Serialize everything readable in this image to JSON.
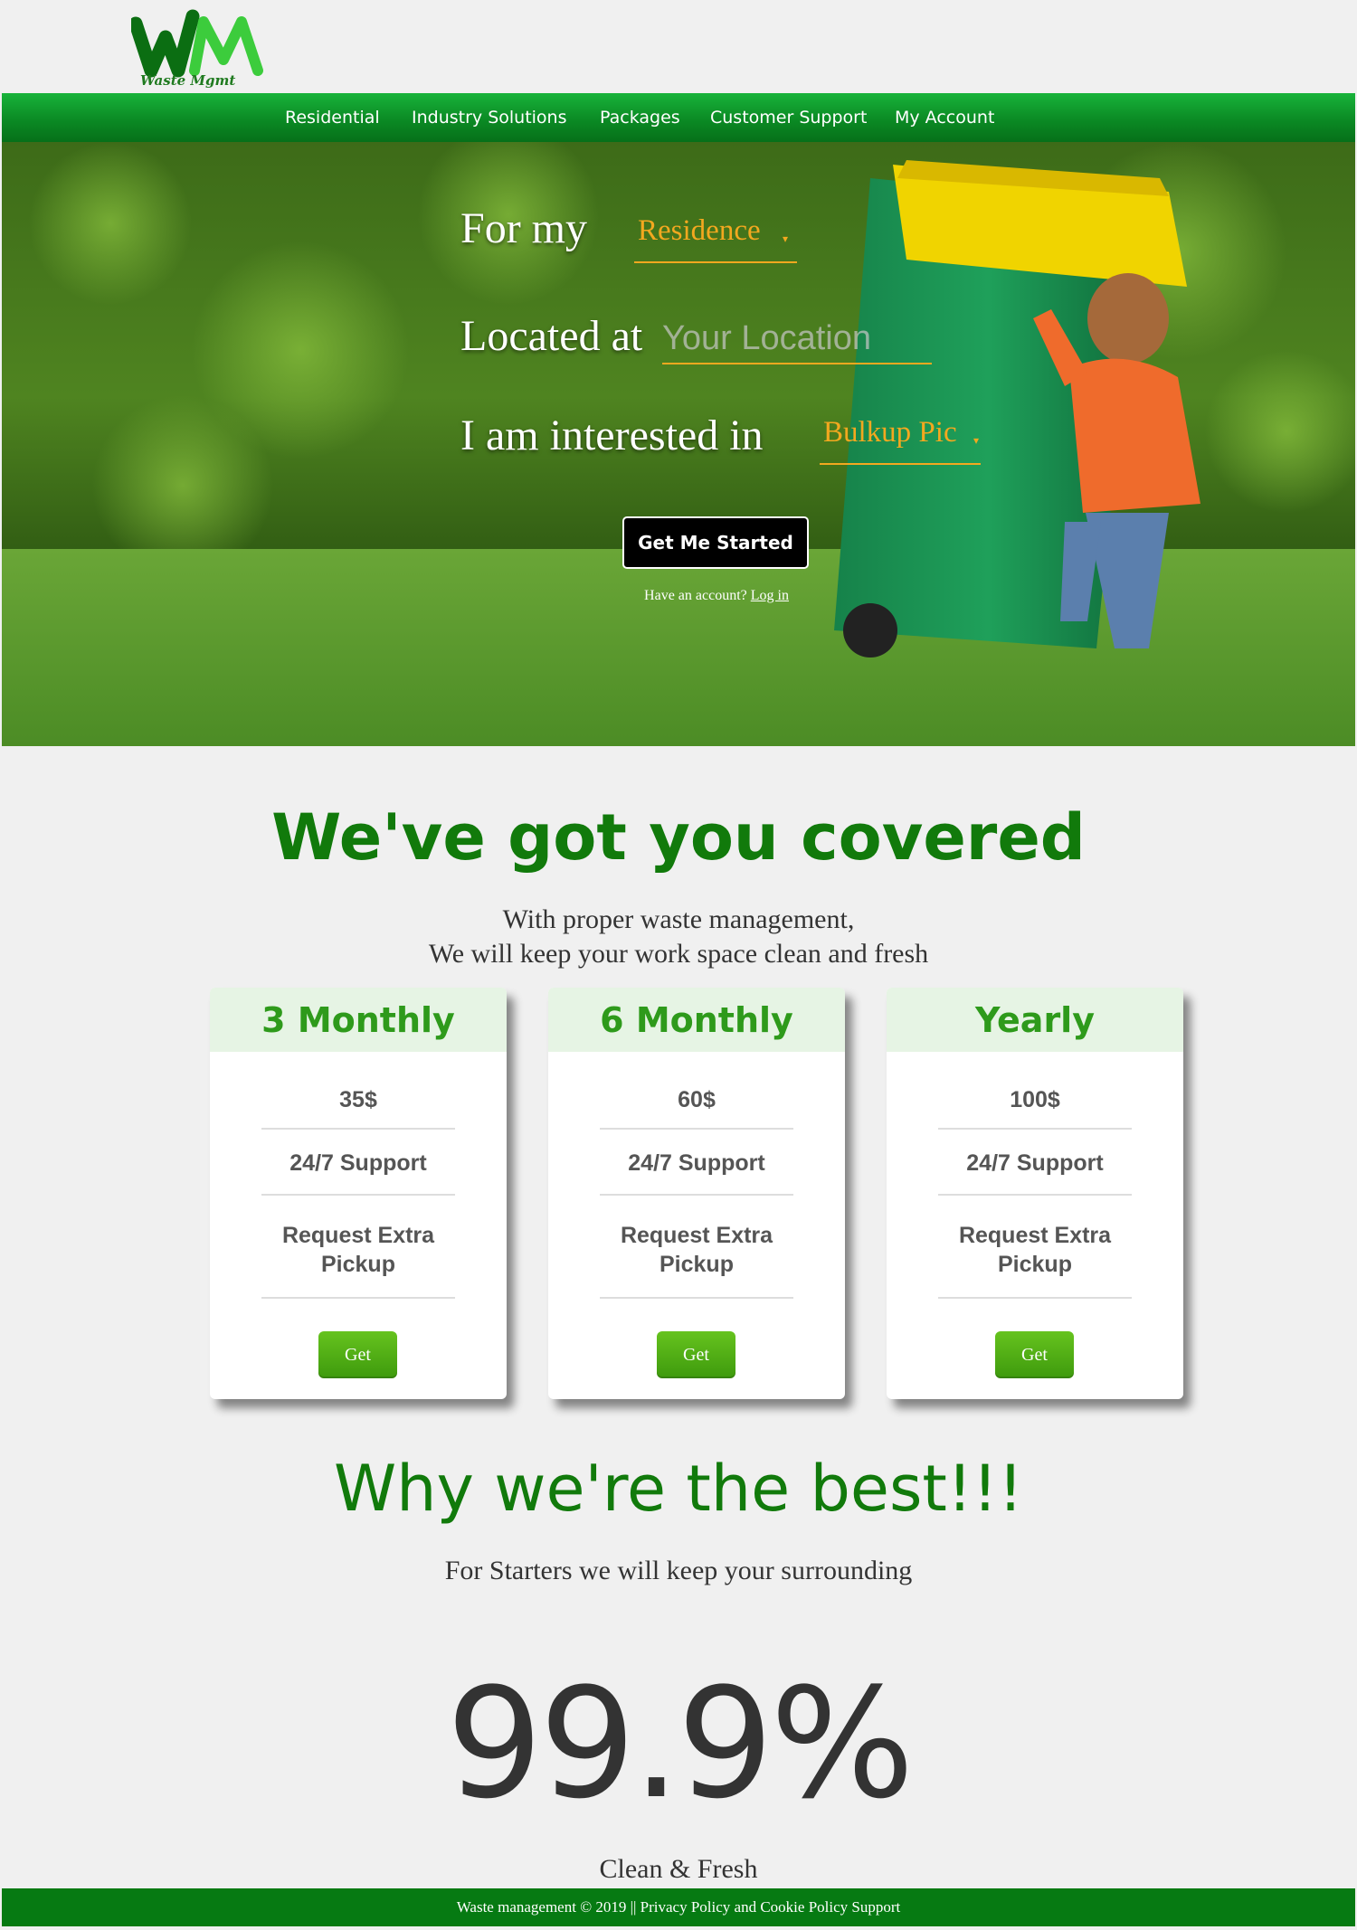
{
  "brand": {
    "logo_text": "Waste Mgmt",
    "colors": {
      "primary_green": "#0b8a24",
      "accent_orange": "#f3a81f",
      "title_green": "#117a0b"
    }
  },
  "nav": {
    "items": [
      {
        "label": "Residential"
      },
      {
        "label": "Industry Solutions"
      },
      {
        "label": "Packages"
      },
      {
        "label": "Customer Support"
      },
      {
        "label": "My Account"
      }
    ]
  },
  "hero": {
    "line1_prefix": "For my",
    "line1_select": "Residence",
    "line2_prefix": "Located at",
    "line2_placeholder": "Your Location",
    "line3_prefix": "I am interested in",
    "line3_select": "Bulkup Pic",
    "cta_label": "Get Me Started",
    "account_text": "Have an account?",
    "login_label": "Log in"
  },
  "covered": {
    "title": "We've got you covered",
    "subtitle_line1": "With proper waste management,",
    "subtitle_line2": "We will keep your work space clean and fresh"
  },
  "plans": [
    {
      "name": "3 Monthly",
      "price": "35$",
      "feature1": "24/7 Support",
      "feature2_line1": "Request Extra",
      "feature2_line2": "Pickup",
      "button": "Get"
    },
    {
      "name": "6 Monthly",
      "price": "60$",
      "feature1": "24/7 Support",
      "feature2_line1": "Request Extra",
      "feature2_line2": "Pickup",
      "button": "Get"
    },
    {
      "name": "Yearly",
      "price": "100$",
      "feature1": "24/7 Support",
      "feature2_line1": "Request Extra",
      "feature2_line2": "Pickup",
      "button": "Get"
    }
  ],
  "best": {
    "title": "Why we're the best!!!",
    "subtitle": "For Starters we will keep your surrounding",
    "stat": "99.9%",
    "stat_caption": "Clean & Fresh"
  },
  "footer": {
    "text": "Waste management © 2019 || Privacy Policy and Cookie Policy Support"
  }
}
